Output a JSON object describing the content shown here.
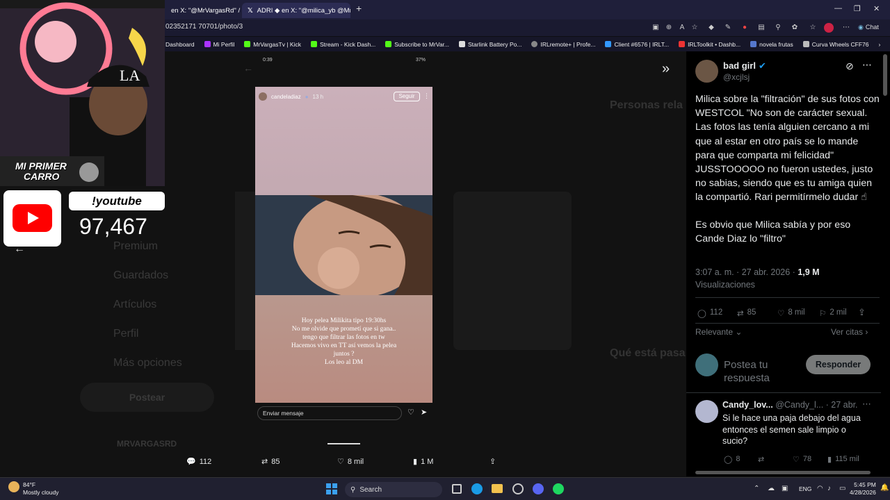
{
  "browser": {
    "tabs": [
      {
        "label": "en X: \"@MrVargasRd\" / X"
      },
      {
        "label": "ADRI ◆ en X: \"@milica_yb @MrVar\""
      }
    ],
    "new_tab": "+",
    "url": "02352171 70701/photo/3",
    "chat_label": "Chat",
    "bookmarks": [
      "Dashboard",
      "Mi Perfil",
      "MrVargasTv | Kick",
      "Stream - Kick Dash...",
      "Subscribe to MrVar...",
      "Starlink Battery Po...",
      "IRLremote+ | Profe...",
      "Client #6576 | IRLT...",
      "IRLToolkit • Dashb...",
      "novela frutas",
      "Curva Wheels CFF76"
    ]
  },
  "overlay": {
    "cam_caption_line1": "MI PRIMER",
    "cam_caption_line2": "CARRO",
    "cmd_label": "!youtube",
    "subscriber_count": "97,467"
  },
  "background_page": {
    "left_menu": [
      "Premium",
      "Guardados",
      "Artículos",
      "Perfil",
      "Más opciones"
    ],
    "post_button": "Postear",
    "section_persons": "Personas rela",
    "section_trending": "Qué está pasa",
    "account_label": "MRVARGASRD"
  },
  "story": {
    "status_time": "0:39",
    "status_batt": "37%",
    "username": "candeladiaz",
    "time_ago": "13 h",
    "follow": "Seguir",
    "text_lines": [
      "Hoy pelea Milikita tipo 19:30hs",
      "No me olvide que prometí que si gana..",
      "tengo que filtrar las fotos en tw",
      "Hacemos vivo en TT así vemos la pelea",
      "juntos ?",
      "Los leo al DM"
    ],
    "message_placeholder": "Enviar mensaje"
  },
  "bottom_stats": {
    "replies": "112",
    "reposts": "85",
    "likes": "8 mil",
    "views": "1 M"
  },
  "tweet": {
    "author": "bad girl",
    "handle": "@xcjlsj",
    "paragraph1": "Milica sobre la \"filtración\" de sus fotos con WESTCOL \"No son de carácter sexual. Las fotos las tenía alguien cercano a mi que al estar en otro país se lo mande para que comparta mi felicidad\" JUSSTOOOOO no fueron ustedes, justo no sabias, siendo que es tu amiga quien la compartió. Rari permitírmelo dudar ☝",
    "paragraph2": "Es obvio que Milica sabía y por eso Cande Diaz lo \"filtro\"",
    "timestamp": "3:07 a. m. · 27 abr. 2026 ·",
    "views_count": "1,9 M",
    "views_label": "Visualizaciones",
    "replies": "112",
    "reposts": "85",
    "likes": "8 mil",
    "bookmarks": "2 mil",
    "sort": "Relevante",
    "quotes": "Ver citas",
    "reply_placeholder": "Postea tu respuesta",
    "reply_button": "Responder"
  },
  "reply": {
    "author": "Candy_lov...",
    "handle": "@Candy_l...",
    "date": "· 27 abr.",
    "text": "Si le hace una paja debajo del agua entonces el semen sale limpio o sucio?",
    "replies": "8",
    "likes": "78",
    "views": "115 mil"
  },
  "taskbar": {
    "weather_temp": "84°F",
    "weather_desc": "Mostly cloudy",
    "search": "Search",
    "lang": "ENG",
    "time": "5:45 PM",
    "date": "4/28/2026"
  },
  "colors": {
    "accent": "#1d9bf0",
    "panel_bg": "#000000",
    "chrome_bg": "#1f1f3a"
  }
}
